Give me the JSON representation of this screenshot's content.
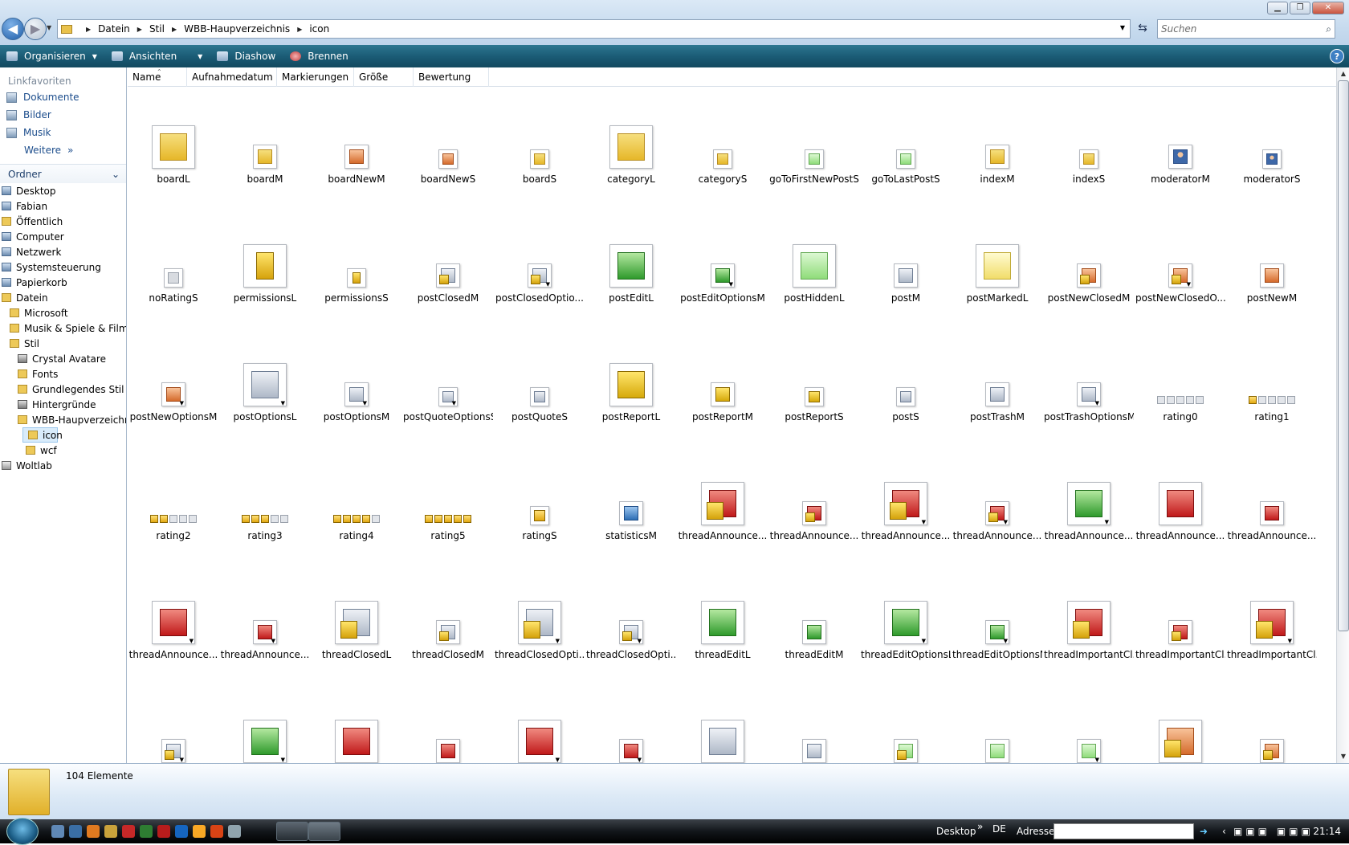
{
  "window": {
    "controls": [
      "minimize",
      "maximize",
      "close"
    ]
  },
  "address": {
    "crumbs": [
      "Datein",
      "Stil",
      "WBB-Haupverzeichnis",
      "icon"
    ],
    "search_placeholder": "Suchen"
  },
  "toolbar": {
    "organize": "Organisieren",
    "views": "Ansichten",
    "slideshow": "Diashow",
    "burn": "Brennen",
    "help": "?"
  },
  "navpane": {
    "favorites_header": "Linkfavoriten",
    "favorites": [
      "Dokumente",
      "Bilder",
      "Musik"
    ],
    "more": "Weitere",
    "folders_header": "Ordner",
    "tree": [
      {
        "label": "Desktop",
        "level": 0,
        "icon": "sys"
      },
      {
        "label": "Fabian",
        "level": 0,
        "icon": "sys"
      },
      {
        "label": "Öffentlich",
        "level": 0,
        "icon": "fold"
      },
      {
        "label": "Computer",
        "level": 0,
        "icon": "sys"
      },
      {
        "label": "Netzwerk",
        "level": 0,
        "icon": "sys"
      },
      {
        "label": "Systemsteuerung",
        "level": 0,
        "icon": "sys"
      },
      {
        "label": "Papierkorb",
        "level": 0,
        "icon": "sys"
      },
      {
        "label": "Datein",
        "level": 0,
        "icon": "fold"
      },
      {
        "label": "Microsoft",
        "level": 1,
        "icon": "fold"
      },
      {
        "label": "Musik & Spiele & Film",
        "level": 1,
        "icon": "fold"
      },
      {
        "label": "Stil",
        "level": 1,
        "icon": "fold"
      },
      {
        "label": "Crystal Avatare",
        "level": 2,
        "icon": "cam"
      },
      {
        "label": "Fonts",
        "level": 2,
        "icon": "fold"
      },
      {
        "label": "Grundlegendes Stil",
        "level": 2,
        "icon": "fold"
      },
      {
        "label": "Hintergründe",
        "level": 2,
        "icon": "cam"
      },
      {
        "label": "WBB-Haupverzeichnis",
        "level": 2,
        "icon": "fold"
      },
      {
        "label": "icon",
        "level": 3,
        "icon": "fold",
        "selected": true
      },
      {
        "label": "wcf",
        "level": 3,
        "icon": "fold"
      },
      {
        "label": "Woltlab",
        "level": 0,
        "icon": "drv"
      }
    ]
  },
  "columns": [
    "Name",
    "Aufnahmedatum",
    "Markierungen",
    "Größe",
    "Bewertung"
  ],
  "items": [
    {
      "name": "boardL",
      "size": "L",
      "glyph": "folder"
    },
    {
      "name": "boardM",
      "size": "M",
      "glyph": "folder"
    },
    {
      "name": "boardNewM",
      "size": "M",
      "glyph": "newb"
    },
    {
      "name": "boardNewS",
      "size": "S",
      "glyph": "newb"
    },
    {
      "name": "boardS",
      "size": "S",
      "glyph": "folder"
    },
    {
      "name": "categoryL",
      "size": "L",
      "glyph": "folder"
    },
    {
      "name": "categoryS",
      "size": "S",
      "glyph": "folder"
    },
    {
      "name": "goToFirstNewPostS",
      "size": "S",
      "glyph": "hidden"
    },
    {
      "name": "goToLastPostS",
      "size": "S",
      "glyph": "hidden"
    },
    {
      "name": "indexM",
      "size": "M",
      "glyph": "folder"
    },
    {
      "name": "indexS",
      "size": "S",
      "glyph": "folder"
    },
    {
      "name": "moderatorM",
      "size": "M",
      "glyph": "user"
    },
    {
      "name": "moderatorS",
      "size": "S",
      "glyph": "user"
    },
    {
      "name": "noRatingS",
      "size": "S",
      "glyph": "gray"
    },
    {
      "name": "permissionsL",
      "size": "L",
      "glyph": "key"
    },
    {
      "name": "permissionsS",
      "size": "S",
      "glyph": "key"
    },
    {
      "name": "postClosedM",
      "size": "M",
      "glyph": "post",
      "lock": true
    },
    {
      "name": "postClosedOptio...",
      "size": "M",
      "glyph": "post",
      "lock": true,
      "dd": true
    },
    {
      "name": "postEditL",
      "size": "L",
      "glyph": "edit"
    },
    {
      "name": "postEditOptionsM",
      "size": "M",
      "glyph": "edit",
      "dd": true
    },
    {
      "name": "postHiddenL",
      "size": "L",
      "glyph": "hidden"
    },
    {
      "name": "postM",
      "size": "M",
      "glyph": "post"
    },
    {
      "name": "postMarkedL",
      "size": "L",
      "glyph": "marked"
    },
    {
      "name": "postNewClosedM",
      "size": "M",
      "glyph": "newb",
      "lock": true
    },
    {
      "name": "postNewClosedO...",
      "size": "M",
      "glyph": "newb",
      "lock": true,
      "dd": true
    },
    {
      "name": "postNewM",
      "size": "M",
      "glyph": "newb"
    },
    {
      "name": "postNewOptionsM",
      "size": "M",
      "glyph": "newb",
      "dd": true
    },
    {
      "name": "postOptionsL",
      "size": "L",
      "glyph": "post",
      "dd": true
    },
    {
      "name": "postOptionsM",
      "size": "M",
      "glyph": "post",
      "dd": true
    },
    {
      "name": "postQuoteOptionsS",
      "size": "S",
      "glyph": "post",
      "dd": true
    },
    {
      "name": "postQuoteS",
      "size": "S",
      "glyph": "post"
    },
    {
      "name": "postReportL",
      "size": "L",
      "glyph": "report"
    },
    {
      "name": "postReportM",
      "size": "M",
      "glyph": "report"
    },
    {
      "name": "postReportS",
      "size": "S",
      "glyph": "report"
    },
    {
      "name": "postS",
      "size": "S",
      "glyph": "post"
    },
    {
      "name": "postTrashM",
      "size": "M",
      "glyph": "post"
    },
    {
      "name": "postTrashOptionsM",
      "size": "M",
      "glyph": "post",
      "dd": true
    },
    {
      "name": "rating0",
      "size": "R",
      "stars": 0
    },
    {
      "name": "rating1",
      "size": "R",
      "stars": 1
    },
    {
      "name": "rating2",
      "size": "R",
      "stars": 2
    },
    {
      "name": "rating3",
      "size": "R",
      "stars": 3
    },
    {
      "name": "rating4",
      "size": "R",
      "stars": 4
    },
    {
      "name": "rating5",
      "size": "R",
      "stars": 5
    },
    {
      "name": "ratingS",
      "size": "S",
      "glyph": "star"
    },
    {
      "name": "statisticsM",
      "size": "M",
      "glyph": "stat"
    },
    {
      "name": "threadAnnounce...",
      "size": "L",
      "glyph": "red",
      "lock": true
    },
    {
      "name": "threadAnnounce...",
      "size": "M",
      "glyph": "red",
      "lock": true
    },
    {
      "name": "threadAnnounce...",
      "size": "L",
      "glyph": "red",
      "lock": true,
      "dd": true
    },
    {
      "name": "threadAnnounce...",
      "size": "M",
      "glyph": "red",
      "lock": true,
      "dd": true
    },
    {
      "name": "threadAnnounce...",
      "size": "L",
      "glyph": "edit",
      "dd": true
    },
    {
      "name": "threadAnnounce...",
      "size": "L",
      "glyph": "red"
    },
    {
      "name": "threadAnnounce...",
      "size": "M",
      "glyph": "red"
    },
    {
      "name": "threadAnnounce...",
      "size": "L",
      "glyph": "red",
      "dd": true
    },
    {
      "name": "threadAnnounce...",
      "size": "M",
      "glyph": "red",
      "dd": true
    },
    {
      "name": "threadClosedL",
      "size": "L",
      "glyph": "post",
      "lock": true
    },
    {
      "name": "threadClosedM",
      "size": "M",
      "glyph": "post",
      "lock": true
    },
    {
      "name": "threadClosedOpti...",
      "size": "L",
      "glyph": "post",
      "lock": true,
      "dd": true
    },
    {
      "name": "threadClosedOpti...",
      "size": "M",
      "glyph": "post",
      "lock": true,
      "dd": true
    },
    {
      "name": "threadEditL",
      "size": "L",
      "glyph": "edit"
    },
    {
      "name": "threadEditM",
      "size": "M",
      "glyph": "edit"
    },
    {
      "name": "threadEditOptionsL",
      "size": "L",
      "glyph": "edit",
      "dd": true
    },
    {
      "name": "threadEditOptionsM",
      "size": "M",
      "glyph": "edit",
      "dd": true
    },
    {
      "name": "threadImportantCl...",
      "size": "L",
      "glyph": "red",
      "lock": true
    },
    {
      "name": "threadImportantCl...",
      "size": "M",
      "glyph": "red",
      "lock": true
    },
    {
      "name": "threadImportantCl...",
      "size": "L",
      "glyph": "red",
      "lock": true,
      "dd": true
    },
    {
      "name": "",
      "size": "M",
      "glyph": "post",
      "lock": true,
      "dd": true
    },
    {
      "name": "",
      "size": "L",
      "glyph": "edit",
      "dd": true
    },
    {
      "name": "",
      "size": "L",
      "glyph": "red"
    },
    {
      "name": "",
      "size": "M",
      "glyph": "red"
    },
    {
      "name": "",
      "size": "L",
      "glyph": "red",
      "dd": true
    },
    {
      "name": "",
      "size": "M",
      "glyph": "red",
      "dd": true
    },
    {
      "name": "",
      "size": "L",
      "glyph": "post"
    },
    {
      "name": "",
      "size": "M",
      "glyph": "post"
    },
    {
      "name": "",
      "size": "M",
      "glyph": "hidden",
      "lock": true
    },
    {
      "name": "",
      "size": "M",
      "glyph": "hidden"
    },
    {
      "name": "",
      "size": "M",
      "glyph": "hidden",
      "dd": true
    },
    {
      "name": "",
      "size": "L",
      "glyph": "newb",
      "lock": true
    },
    {
      "name": "",
      "size": "M",
      "glyph": "newb",
      "lock": true
    }
  ],
  "status": {
    "count": "104 Elemente"
  },
  "taskbar": {
    "desktop": "Desktop",
    "lang": "DE",
    "address_label": "Adresse",
    "chevron": "»",
    "clock": "21:14"
  }
}
